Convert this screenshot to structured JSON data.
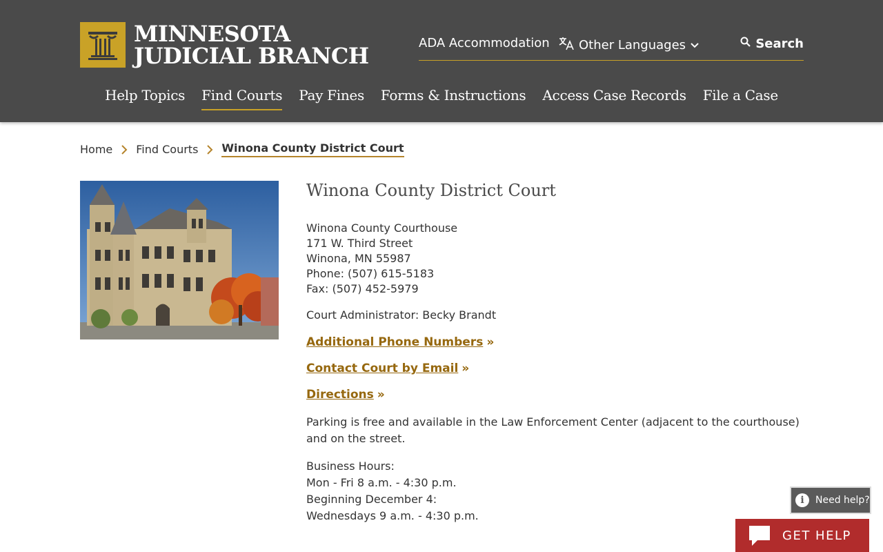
{
  "header": {
    "logo_line1": "MINNESOTA",
    "logo_line2": "JUDICIAL BRANCH",
    "utility": {
      "ada": "ADA Accommodation",
      "languages": "Other Languages",
      "search": "Search"
    },
    "nav": [
      {
        "label": "Help Topics"
      },
      {
        "label": "Find Courts"
      },
      {
        "label": "Pay Fines"
      },
      {
        "label": "Forms & Instructions"
      },
      {
        "label": "Access Case Records"
      },
      {
        "label": "File a Case"
      }
    ]
  },
  "breadcrumb": {
    "home": "Home",
    "parent": "Find Courts",
    "current": "Winona County District Court"
  },
  "court": {
    "title": "Winona County District Court",
    "address_lines": [
      "Winona County Courthouse",
      "171 W. Third Street",
      "Winona, MN 55987",
      "Phone: (507) 615-5183",
      "Fax: (507) 452-5979"
    ],
    "administrator": "Court Administrator: Becky Brandt",
    "links": [
      {
        "label": "Additional Phone Numbers"
      },
      {
        "label": "Contact Court by Email"
      },
      {
        "label": "Directions"
      }
    ],
    "link_arrow": "»",
    "parking": "Parking is free and available in the Law Enforcement Center (adjacent to the courthouse) and on the street.",
    "hours_lines": [
      "Business Hours:",
      "Mon - Fri 8 a.m. - 4:30 p.m.",
      "Beginning December 4:",
      "Wednesdays 9 a.m. - 4:30 p.m."
    ]
  },
  "widgets": {
    "need_help": "Need help?",
    "info_glyph": "i",
    "get_help": "GET HELP"
  },
  "colors": {
    "header_bg": "#4a4a4a",
    "gold": "#c9a227",
    "link": "#96680f",
    "get_help_bg": "#b12c2c"
  },
  "icons": [
    "pillar-logo-icon",
    "translate-icon",
    "chevron-down-icon",
    "search-icon",
    "chevron-right-icon",
    "info-icon",
    "chat-bubble-icon"
  ]
}
